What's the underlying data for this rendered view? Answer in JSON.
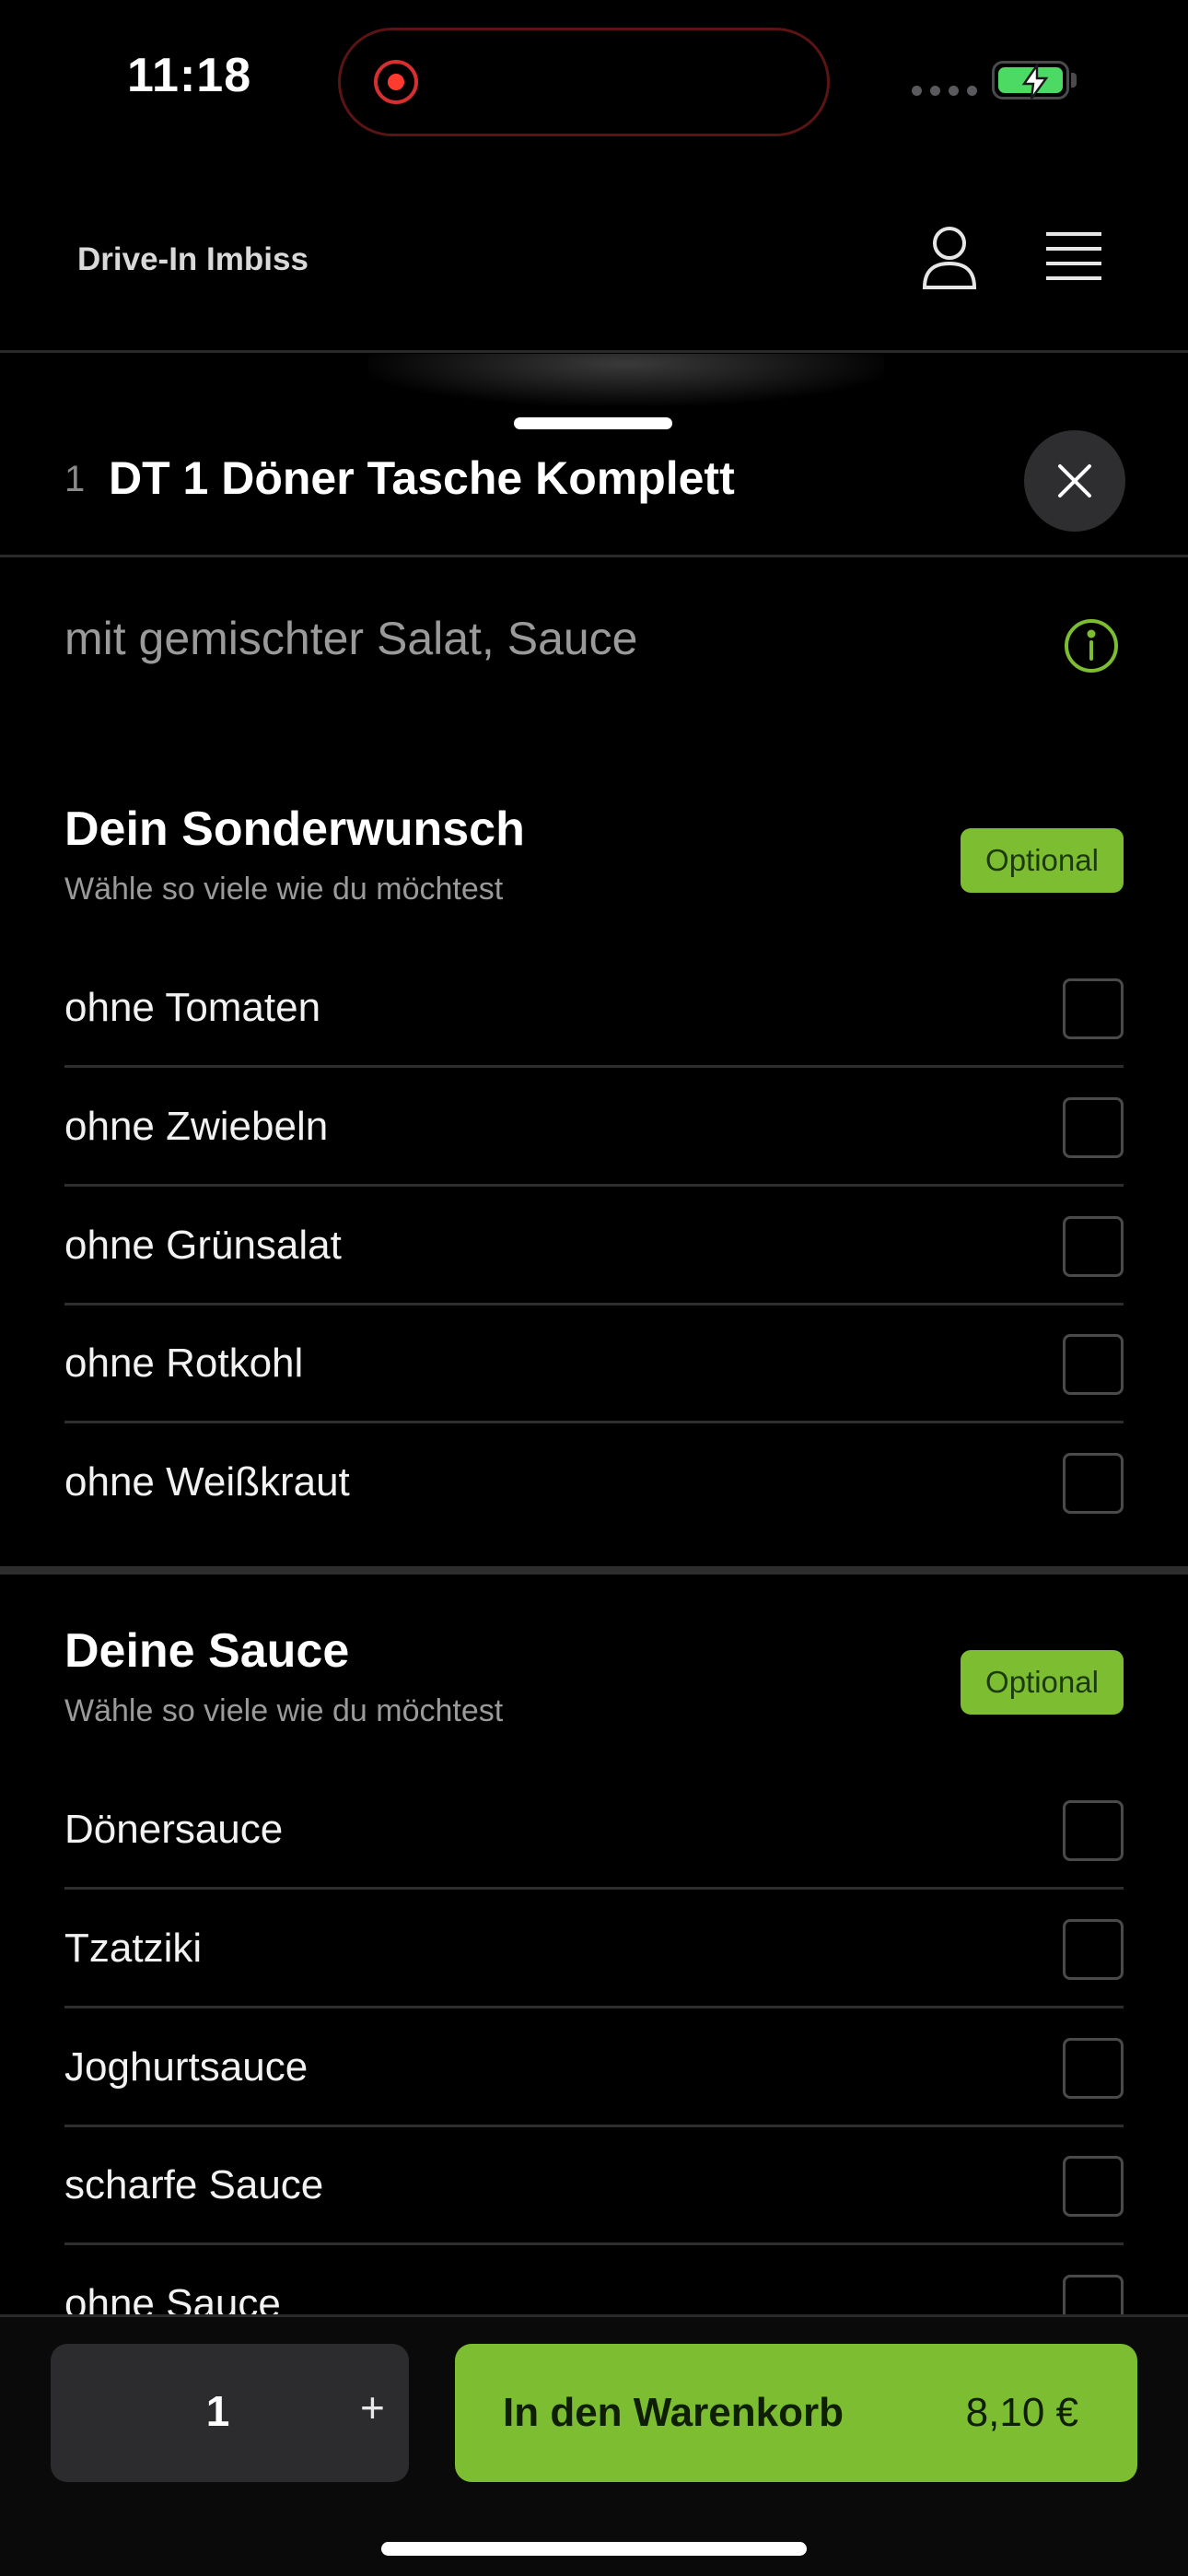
{
  "status_bar": {
    "time": "11:18"
  },
  "header": {
    "brand": "Drive-In Imbiss",
    "icons": [
      "user-icon",
      "menu-icon"
    ]
  },
  "item": {
    "number": "1",
    "title": "DT 1 Döner Tasche Komplett",
    "description": "mit gemischter Salat, Sauce"
  },
  "groups": [
    {
      "title": "Dein Sonderwunsch",
      "subtitle": "Wähle so viele wie du möchtest",
      "badge": "Optional",
      "options": [
        {
          "label": "ohne Tomaten",
          "checked": false
        },
        {
          "label": "ohne Zwiebeln",
          "checked": false
        },
        {
          "label": "ohne Grünsalat",
          "checked": false
        },
        {
          "label": "ohne Rotkohl",
          "checked": false
        },
        {
          "label": "ohne Weißkraut",
          "checked": false
        }
      ]
    },
    {
      "title": "Deine Sauce",
      "subtitle": "Wähle so viele wie du möchtest",
      "badge": "Optional",
      "options": [
        {
          "label": "Dönersauce",
          "checked": false
        },
        {
          "label": "Tzatziki",
          "checked": false
        },
        {
          "label": "Joghurtsauce",
          "checked": false
        },
        {
          "label": "scharfe Sauce",
          "checked": false
        },
        {
          "label": "ohne Sauce",
          "checked": false
        }
      ]
    }
  ],
  "bottom": {
    "quantity": "1",
    "plus_label": "+",
    "cart_label": "In den Warenkorb",
    "price": "8,10 €"
  },
  "colors": {
    "accent": "#7cbd32",
    "background": "#000000",
    "surface": "#2c2c2e"
  }
}
